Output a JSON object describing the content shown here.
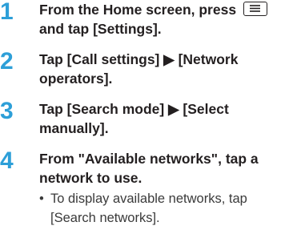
{
  "steps": [
    {
      "number": "1",
      "text_before_icon": "From the Home screen, press",
      "icon": "menu-key-icon",
      "text_after_icon": "and tap [Settings]."
    },
    {
      "number": "2",
      "text": "Tap [Call settings] ▶ [Network operators]."
    },
    {
      "number": "3",
      "text": "Tap [Search mode] ▶ [Select manually]."
    },
    {
      "number": "4",
      "text": "From \"Available networks\", tap a network to use.",
      "note_bullet": "•",
      "note_line1": "To display available networks, tap",
      "note_line2": "[Search networks]."
    }
  ],
  "colors": {
    "step_number": "#2d9fd8",
    "text": "#231f20"
  }
}
